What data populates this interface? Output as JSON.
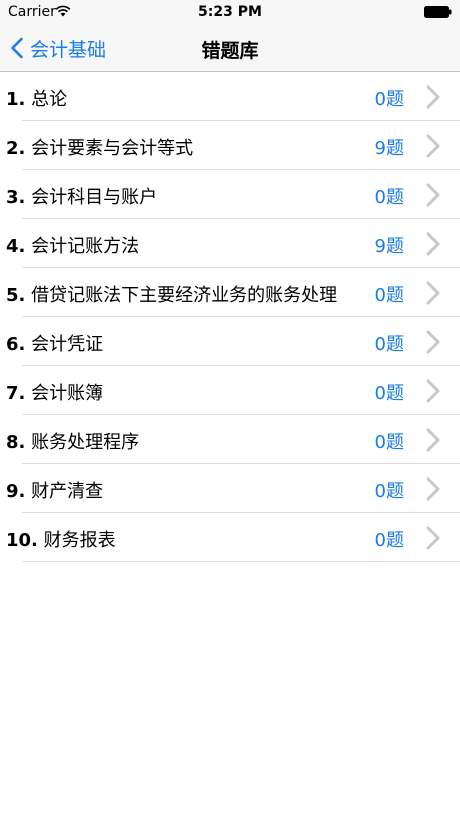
{
  "status_bar": {
    "carrier": "Carrier",
    "time": "5:23 PM",
    "wifi_icon": "wifi-icon",
    "battery_icon": "battery-icon"
  },
  "nav": {
    "back_label": "会计基础",
    "back_icon": "chevron-left-icon",
    "title": "错题库"
  },
  "colors": {
    "accent": "#1a7ce6",
    "nav_background": "#f7f7f7",
    "separator": "#dcdce0",
    "chevron": "#c7c7cc"
  },
  "chapters": [
    {
      "number": "1.",
      "title": "总论",
      "count": "0题"
    },
    {
      "number": "2.",
      "title": "会计要素与会计等式",
      "count": "9题"
    },
    {
      "number": "3.",
      "title": "会计科目与账户",
      "count": "0题"
    },
    {
      "number": "4.",
      "title": "会计记账方法",
      "count": "9题"
    },
    {
      "number": "5.",
      "title": "借贷记账法下主要经济业务的账务处理",
      "count": "0题"
    },
    {
      "number": "6.",
      "title": "会计凭证",
      "count": "0题"
    },
    {
      "number": "7.",
      "title": "会计账簿",
      "count": "0题"
    },
    {
      "number": "8.",
      "title": "账务处理程序",
      "count": "0题"
    },
    {
      "number": "9.",
      "title": "财产清查",
      "count": "0题"
    },
    {
      "number": "10.",
      "title": "财务报表",
      "count": "0题"
    }
  ]
}
